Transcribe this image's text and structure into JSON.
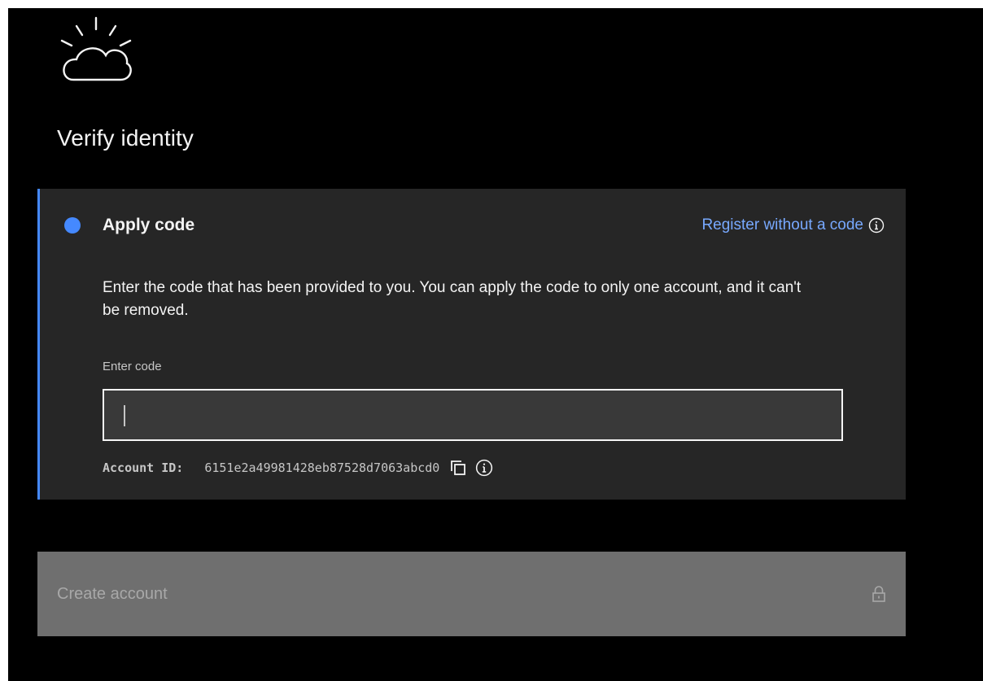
{
  "page": {
    "title": "Verify identity",
    "logo_icon": "ibm-cloud-sun-icon"
  },
  "step": {
    "title": "Apply code",
    "status_color": "#4589ff",
    "register_link": "Register without a code",
    "description": "Enter the code that has been provided to you. You can apply the code to only one account, and it can't be removed.",
    "field_label": "Enter code",
    "field_value": "",
    "field_placeholder": "",
    "account_label": "Account ID:",
    "account_id": "6151e2a49981428eb87528d7063abcd0",
    "icons": [
      "info-icon",
      "copy-icon",
      "info-icon"
    ]
  },
  "footer": {
    "create_label": "Create account",
    "create_disabled": true,
    "lock_icon": "lock-icon"
  },
  "colors": {
    "background": "#000000",
    "card": "#262626",
    "accent": "#4589ff",
    "link": "#78a9ff",
    "button_disabled": "#6f6f6f"
  }
}
